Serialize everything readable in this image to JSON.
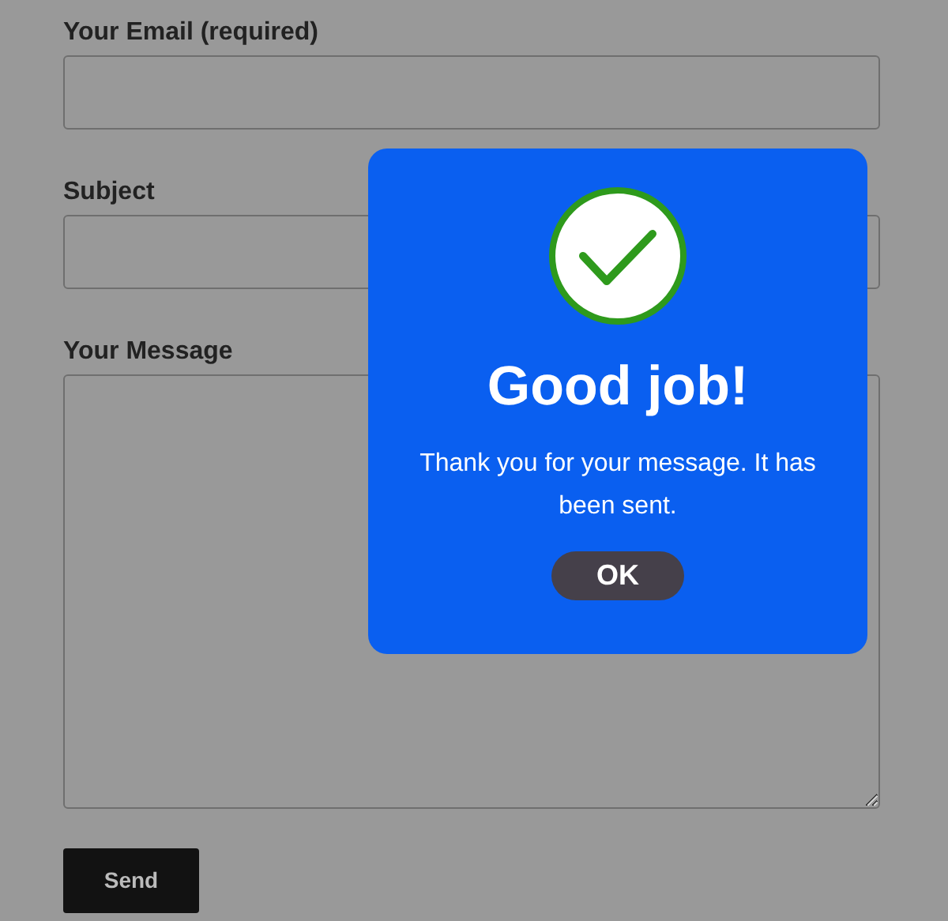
{
  "form": {
    "fields": [
      {
        "label": "Your Email (required)",
        "kind": "input"
      },
      {
        "label": "Subject",
        "kind": "input"
      },
      {
        "label": "Your Message",
        "kind": "textarea"
      }
    ],
    "submit": "Send"
  },
  "dialog": {
    "title": "Good job!",
    "message": "Thank you for your message. It has been sent.",
    "button": "OK"
  }
}
